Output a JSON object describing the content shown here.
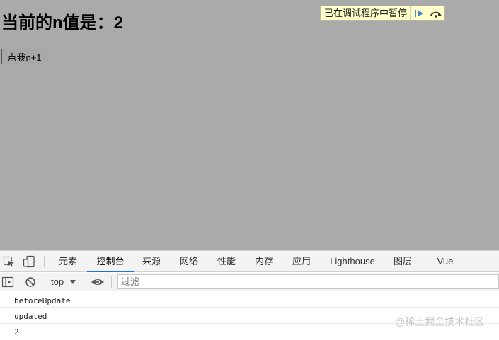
{
  "page": {
    "heading": "当前的n值是：2",
    "button_label": "点我n+1"
  },
  "debugger_banner": {
    "text": "已在调试程序中暂停",
    "resume_icon": "resume-icon",
    "step_over_icon": "step-over-icon"
  },
  "devtools": {
    "tabs": [
      {
        "label": "元素"
      },
      {
        "label": "控制台",
        "active": true
      },
      {
        "label": "来源"
      },
      {
        "label": "网络"
      },
      {
        "label": "性能"
      },
      {
        "label": "内存"
      },
      {
        "label": "应用"
      },
      {
        "label": "Lighthouse"
      },
      {
        "label": "图层"
      },
      {
        "label": "Vue"
      }
    ],
    "accent_color": "#1a73e8",
    "toolbar": {
      "context": "top",
      "filter_placeholder": "过滤"
    },
    "console_lines": [
      "beforeUpdate",
      "updated",
      "2"
    ]
  },
  "watermark": "@稀土掘金技术社区"
}
